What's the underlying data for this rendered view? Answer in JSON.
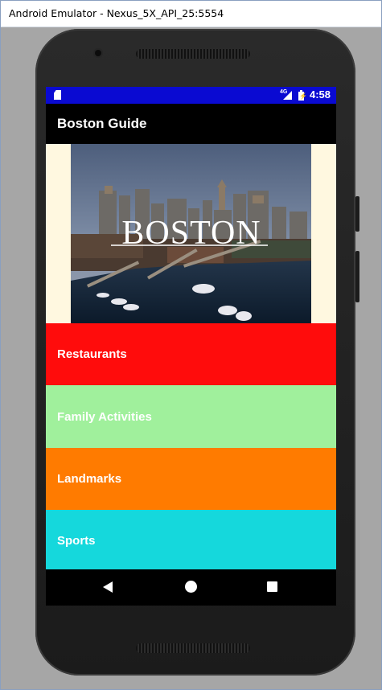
{
  "window": {
    "title": "Android Emulator - Nexus_5X_API_25:5554"
  },
  "status_bar": {
    "network": "4G",
    "time": "4:58",
    "bg_color": "#0a0ad2"
  },
  "app_bar": {
    "title": "Boston Guide"
  },
  "hero": {
    "text": "BOSTON",
    "bg_color": "#fff8e0"
  },
  "categories": [
    {
      "label": "Restaurants",
      "color": "#ff0c0c"
    },
    {
      "label": "Family Activities",
      "color": "#a0f09c"
    },
    {
      "label": "Landmarks",
      "color": "#ff7b00"
    },
    {
      "label": "Sports",
      "color": "#15d8dc"
    }
  ],
  "nav_bar": {
    "back_icon": "back-icon",
    "home_icon": "home-icon",
    "recents_icon": "recents-icon"
  }
}
